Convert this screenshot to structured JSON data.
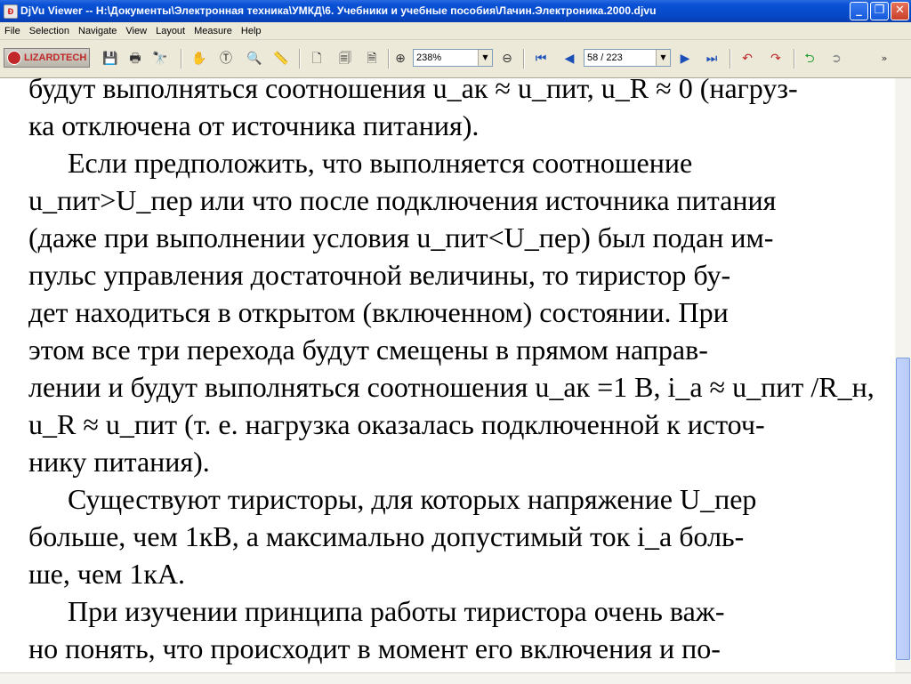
{
  "window": {
    "title": "DjVu Viewer -- H:\\Документы\\Электронная техника\\УМКД\\6. Учебники и учебные пособия\\Лачин.Электроника.2000.djvu",
    "icon": "djvu-icon"
  },
  "menu": [
    "File",
    "Selection",
    "Navigate",
    "View",
    "Layout",
    "Measure",
    "Help"
  ],
  "toolbar": {
    "logo_text": "LIZARDTECH",
    "zoom_value": "238%",
    "page_value": "58 / 223",
    "icons": [
      "save-icon",
      "print-icon",
      "find-icon",
      "hand-icon",
      "text-select-icon",
      "zoom-tool-icon",
      "ruler-icon",
      "page-icon",
      "thumbnail-icon",
      "page-layout-icon",
      "zoom-in-icon",
      "zoom-out-icon",
      "first-page-icon",
      "previous-page-icon",
      "next-page-icon",
      "last-page-icon",
      "rotate-left-icon",
      "rotate-right-icon",
      "back-icon",
      "forward-icon"
    ]
  },
  "page_text": [
    "будут выполняться соотношения u_ак ≈ u_пит, u_R ≈ 0 (нагруз-",
    "ка отключена от источника питания).",
    "Если предположить, что выполняется соотношение",
    "u_пит>U_пер или что после подключения источника питания",
    "(даже при выполнении условия u_пит<U_пер) был подан им-",
    "пульс управления достаточной величины, то тиристор бу-",
    "дет находиться в открытом (включенном) состоянии. При",
    "этом все три перехода будут смещены в прямом направ-",
    "лении и будут выполняться соотношения u_ак =1 В, i_a ≈ u_пит /R_н,",
    "u_R ≈ u_пит (т. е. нагрузка оказалась подключенной к источ-",
    "нику питания).",
    "Существуют тиристоры, для которых напряжение U_пер",
    "больше, чем 1кВ, а максимально допустимый ток i_a боль-",
    "ше, чем 1кА.",
    "При изучении принципа работы тиристора очень важ-",
    "но понять, что происходит в момент его включения и по-"
  ]
}
